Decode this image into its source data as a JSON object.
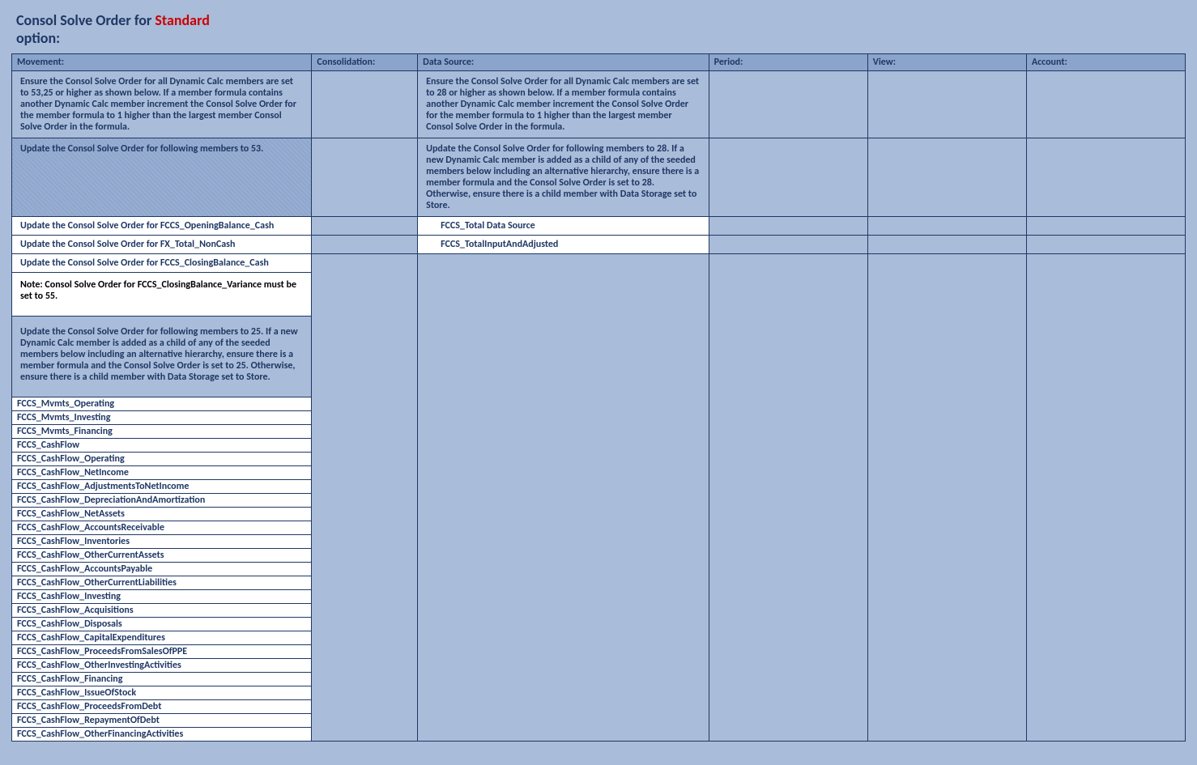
{
  "title": {
    "prefix": "Consol Solve Order for ",
    "standard": "Standard",
    "suffix": " option:"
  },
  "headers": {
    "movement": "Movement:",
    "consolidation": "Consolidation:",
    "dataSource": "Data Source:",
    "period": "Period:",
    "view": "View:",
    "account": "Account:"
  },
  "movement": {
    "intro": "Ensure the Consol Solve Order for all Dynamic Calc members are set to 53,25 or higher as shown below.  If a member formula contains another Dynamic Calc member increment the Consol Solve Order for the member formula to 1 higher than the largest member Consol Solve Order in the formula.",
    "update53": "Update the Consol Solve Order for following members to 53.",
    "rowOpening": "Update the Consol Solve Order for FCCS_OpeningBalance_Cash",
    "rowFx": "Update the Consol Solve Order for FX_Total_NonCash",
    "rowClosing": "Update the Consol Solve Order for FCCS_ClosingBalance_Cash",
    "note": "Note:   Consol Solve Order for FCCS_ClosingBalance_Variance must be set to 55.",
    "update25": "Update the Consol Solve Order for following members to 25.  If a new Dynamic Calc member is added as a child of any of the seeded members below including an alternative hierarchy, ensure there is a member formula and the Consol Solve Order is set to 25. Otherwise, ensure there is a child member with Data Storage set to Store.",
    "members": [
      "FCCS_Mvmts_Operating",
      "FCCS_Mvmts_Investing",
      "FCCS_Mvmts_Financing",
      "FCCS_CashFlow",
      "FCCS_CashFlow_Operating",
      "FCCS_CashFlow_NetIncome",
      "FCCS_CashFlow_AdjustmentsToNetIncome",
      "FCCS_CashFlow_DepreciationAndAmortization",
      "FCCS_CashFlow_NetAssets",
      "FCCS_CashFlow_AccountsReceivable",
      "FCCS_CashFlow_Inventories",
      "FCCS_CashFlow_OtherCurrentAssets",
      "FCCS_CashFlow_AccountsPayable",
      "FCCS_CashFlow_OtherCurrentLiabilities",
      "FCCS_CashFlow_Investing",
      "FCCS_CashFlow_Acquisitions",
      "FCCS_CashFlow_Disposals",
      "FCCS_CashFlow_CapitalExpenditures",
      "FCCS_CashFlow_ProceedsFromSalesOfPPE",
      "FCCS_CashFlow_OtherInvestingActivities",
      "FCCS_CashFlow_Financing",
      "FCCS_CashFlow_IssueOfStock",
      "FCCS_CashFlow_ProceedsFromDebt",
      "FCCS_CashFlow_RepaymentOfDebt",
      "FCCS_CashFlow_OtherFinancingActivities"
    ]
  },
  "dataSource": {
    "intro": "Ensure the Consol Solve Order for all Dynamic Calc members are set to 28 or higher as shown below.  If a member formula contains another Dynamic Calc member increment the Consol Solve Order for the member formula to 1 higher than the largest member Consol Solve Order in the formula.",
    "update28": "Update the Consol Solve Order for following members to 28.  If a new Dynamic Calc member is added as a child of any of the seeded members below including an alternative hierarchy, ensure there is a member formula and the Consol Solve Order is set to 28. Otherwise, ensure there is a child member with Data Storage set to Store.",
    "rowTotalDS": "FCCS_Total Data Source",
    "rowTotalInputAdj": "FCCS_TotalInputAndAdjusted"
  }
}
